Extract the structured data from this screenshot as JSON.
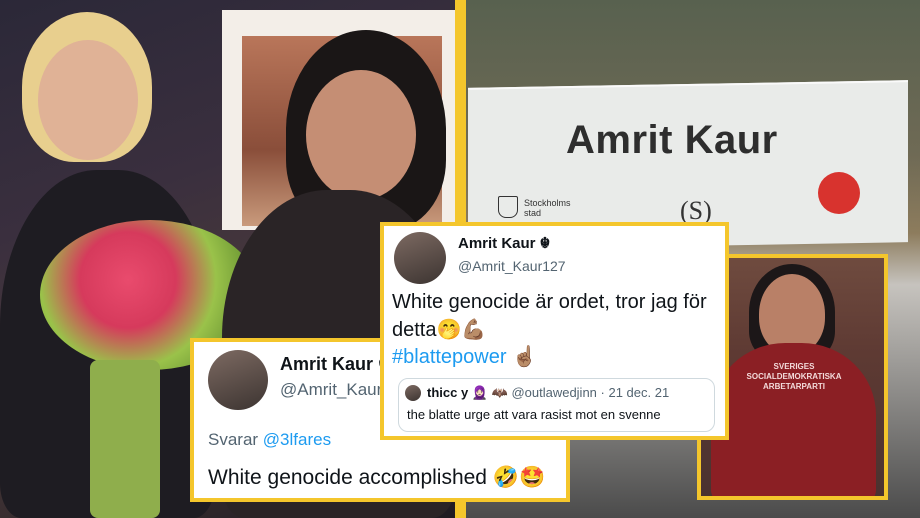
{
  "colors": {
    "accent": "#f4c62c",
    "link": "#1d9bf0",
    "party_red": "#d8332e"
  },
  "left_photo": {
    "description": ""
  },
  "nameplate": {
    "name": "Amrit Kaur",
    "city_line1": "Stockholms",
    "city_line2": "stad",
    "party": "(S)"
  },
  "small_photo": {
    "sweater_text": [
      "SVERIGES",
      "SOCIALDEMOKRATISKA",
      "ARBETARPARTI"
    ]
  },
  "tweet_reply": {
    "name": "Amrit Kaur ☬",
    "handle": "@Amrit_Kaur",
    "replying_prefix": "Svarar ",
    "replying_to": "@3lfares",
    "text": "White genocide accomplished 🤣🤩"
  },
  "tweet_main": {
    "name": "Amrit Kaur ☬",
    "handle": "@Amrit_Kaur127",
    "text": "White genocide är ordet, tror jag för detta🤭💪🏽",
    "hashtag": "#blattepower",
    "hashtag_emoji": "☝🏽",
    "quote": {
      "name": "thicc y",
      "name_emoji": "🧕🏻 🦇",
      "handle": "@outlawedjinn",
      "date": "· 21 dec. 21",
      "text": "the blatte urge att vara rasist mot en svenne"
    }
  }
}
